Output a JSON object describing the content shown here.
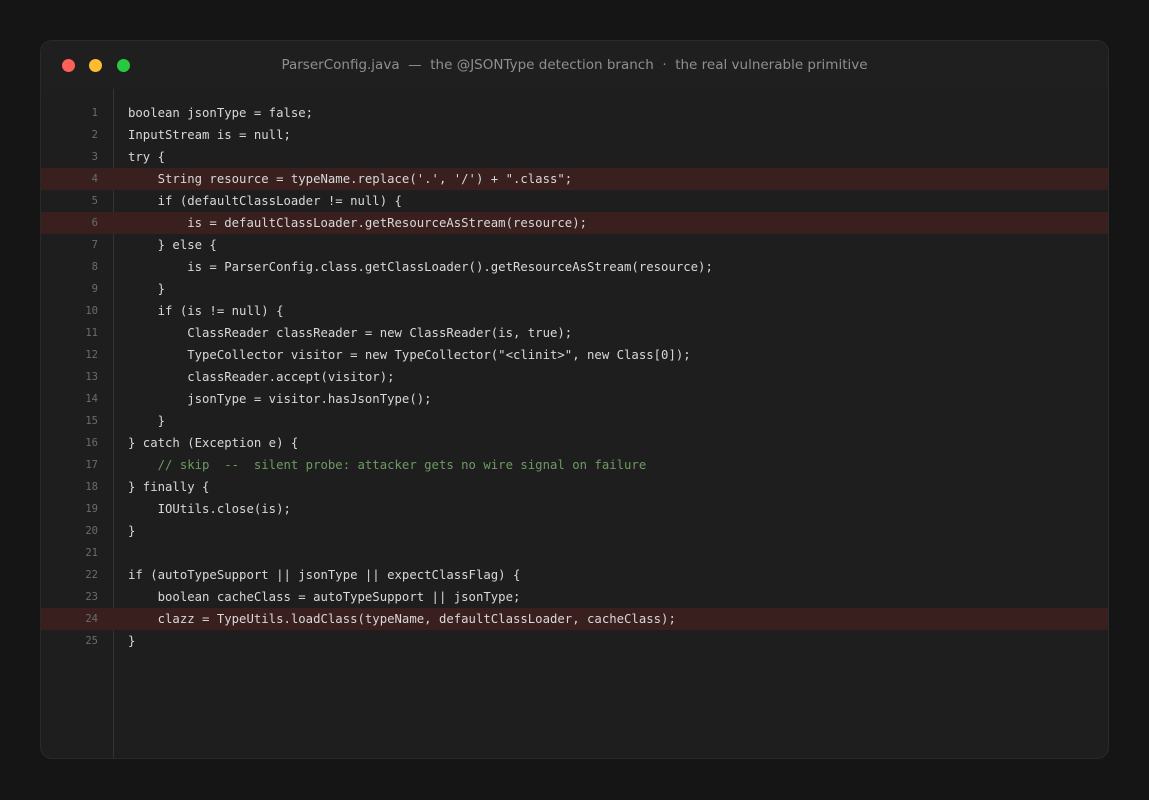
{
  "window": {
    "title": "ParserConfig.java  —  the @JSONType detection branch  ·  the real vulnerable primitive",
    "traffic_lights": [
      "close",
      "minimize",
      "maximize"
    ]
  },
  "colors": {
    "highlight_row": "#3a1f1f",
    "comment": "#6d9a63",
    "close": "#ff5f57",
    "minimize": "#febc2e",
    "maximize": "#28c840"
  },
  "code": {
    "lines": [
      {
        "num": "1",
        "text": "boolean jsonType = false;"
      },
      {
        "num": "2",
        "text": "InputStream is = null;"
      },
      {
        "num": "3",
        "text": "try {"
      },
      {
        "num": "4",
        "text": "    String resource = typeName.replace('.', '/') + \".class\";",
        "highlighted": true
      },
      {
        "num": "5",
        "text": "    if (defaultClassLoader != null) {"
      },
      {
        "num": "6",
        "text": "        is = defaultClassLoader.getResourceAsStream(resource);",
        "highlighted": true
      },
      {
        "num": "7",
        "text": "    } else {"
      },
      {
        "num": "8",
        "text": "        is = ParserConfig.class.getClassLoader().getResourceAsStream(resource);"
      },
      {
        "num": "9",
        "text": "    }"
      },
      {
        "num": "10",
        "text": "    if (is != null) {"
      },
      {
        "num": "11",
        "text": "        ClassReader classReader = new ClassReader(is, true);"
      },
      {
        "num": "12",
        "text": "        TypeCollector visitor = new TypeCollector(\"<clinit>\", new Class[0]);"
      },
      {
        "num": "13",
        "text": "        classReader.accept(visitor);"
      },
      {
        "num": "14",
        "text": "        jsonType = visitor.hasJsonType();"
      },
      {
        "num": "15",
        "text": "    }"
      },
      {
        "num": "16",
        "text": "} catch (Exception e) {"
      },
      {
        "num": "17",
        "text": "    // skip  --  silent probe: attacker gets no wire signal on failure",
        "comment": true
      },
      {
        "num": "18",
        "text": "} finally {"
      },
      {
        "num": "19",
        "text": "    IOUtils.close(is);"
      },
      {
        "num": "20",
        "text": "}"
      },
      {
        "num": "21",
        "text": ""
      },
      {
        "num": "22",
        "text": "if (autoTypeSupport || jsonType || expectClassFlag) {"
      },
      {
        "num": "23",
        "text": "    boolean cacheClass = autoTypeSupport || jsonType;"
      },
      {
        "num": "24",
        "text": "    clazz = TypeUtils.loadClass(typeName, defaultClassLoader, cacheClass);",
        "highlighted": true
      },
      {
        "num": "25",
        "text": "}"
      }
    ]
  }
}
